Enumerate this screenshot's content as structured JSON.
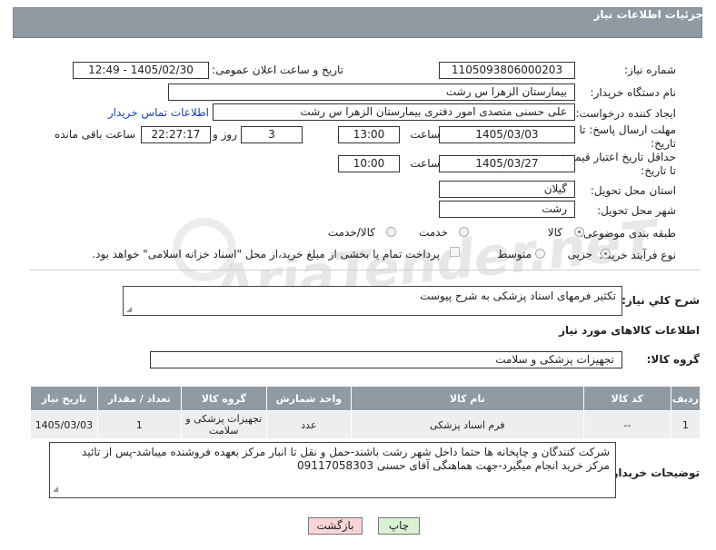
{
  "header": {
    "title": "جزئیات اطلاعات نیاز"
  },
  "form": {
    "need_number_label": "شماره نیاز:",
    "need_number": "1105093806000203",
    "announce_label": "تاریخ و ساعت اعلان عمومی:",
    "announce_value": "1405/02/30 - 12:49",
    "buyer_org_label": "نام دستگاه خریدار:",
    "buyer_org": "بیمارستان الزهرا  س  رشت",
    "creator_label": "ایجاد کننده درخواست:",
    "creator": "علی حسنی متصدی امور دفتری بیمارستان الزهرا  س  رشت",
    "contact_link": "اطلاعات تماس خریدار",
    "deadline_label_1": "مهلت ارسال پاسخ: تا",
    "deadline_label_2": "تاریخ:",
    "deadline_date": "1405/03/03",
    "hour_label": "ساعت",
    "deadline_time": "13:00",
    "days_value": "3",
    "days_label": "روز و",
    "remaining_time": "22:27:17",
    "remaining_label": "ساعت باقی مانده",
    "price_label_1": "حداقل تاریخ اعتبار قیمت:",
    "price_label_2": "تا تاریخ:",
    "price_date": "1405/03/27",
    "price_time": "10:00",
    "province_label": "استان محل تحویل:",
    "province": "گیلان",
    "city_label": "شهر محل تحویل:",
    "city": "رشت",
    "category_label": "طبقه بندی موضوعی:",
    "category_options": [
      "کالا",
      "خدمت",
      "کالا/خدمت"
    ],
    "category_selected": "کالا",
    "process_label": "نوع فرآیند خرید :",
    "process_options": [
      "جزیی",
      "متوسط"
    ],
    "process_selected": "جزیی",
    "payment_note": "پرداخت تمام یا بخشی از مبلغ خرید،از محل \"اسناد خزانه اسلامی\" خواهد بود."
  },
  "summary": {
    "label": "شرح کلي نياز:",
    "text": "تکثیر فرمهای اسناد پزشکی به شرح پیوست"
  },
  "goods_info": {
    "title": "اطلاعات کالاهای مورد نیاز",
    "group_label": "گروه کالا:",
    "group_value": "تجهیزات پزشکی و سلامت"
  },
  "table": {
    "headers": [
      "ردیف",
      "کد کالا",
      "نام کالا",
      "واحد شمارش",
      "گروه کالا",
      "تعداد / مقدار",
      "تاریخ نیاز"
    ],
    "rows": [
      [
        "1",
        "--",
        "فرم اسناد پزشکی",
        "عدد",
        "تجهیزات پزشکی و سلامت",
        "1",
        "1405/03/03"
      ]
    ]
  },
  "buyer_notes": {
    "label": "توضیحات خریدار:",
    "text": "شرکت کنندگان و چاپخانه ها حتما داخل شهر رشت باشند-حمل و نقل تا انبار مرکز بعهده فروشنده میباشد-پس از تائید مرکز خرید انجام میگیرد-جهت هماهنگی آقای حسنی 09117058303"
  },
  "buttons": {
    "print": "چاپ",
    "back": "بازگشت"
  },
  "watermark": "AriaTender.neT",
  "colors": {
    "header_bg": "#8f9aa3",
    "link": "#1a3fb0",
    "back_button_bg": "#f8d6d6",
    "print_button_bg": "#d9f2d4"
  }
}
